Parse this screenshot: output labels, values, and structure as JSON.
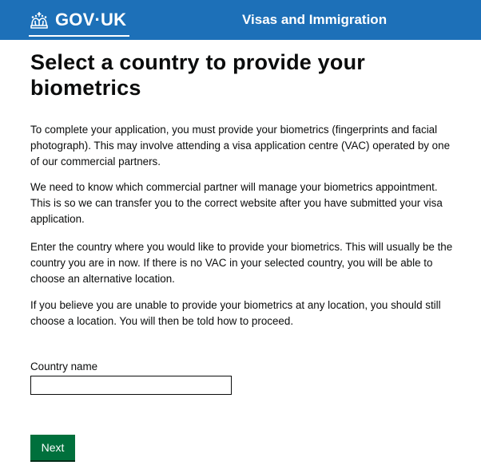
{
  "header": {
    "logo_text": "GOV·UK",
    "crown_icon": "crown-icon",
    "service_name": "Visas and Immigration",
    "background_color": "#1d70b8"
  },
  "main": {
    "title": "Select a country to provide your biometrics",
    "paragraphs": [
      "To complete your application, you must provide your biometrics (fingerprints and facial photograph). This may involve attending a visa application centre (VAC) operated by one of our commercial partners.",
      "We need to know which commercial partner will manage your biometrics appointment. This is so we can transfer you to the correct website after you have submitted your visa application.",
      "Enter the country where you would like to provide your biometrics. This will usually be the country you are in now. If there is no VAC in your selected country, you will be able to choose an alternative location.",
      "If you believe you are unable to provide your biometrics at any location, you should still choose a location. You will then be told how to proceed."
    ],
    "country_field": {
      "label": "Country name",
      "value": ""
    },
    "next_button": {
      "label": "Next",
      "color": "#00703c"
    }
  }
}
